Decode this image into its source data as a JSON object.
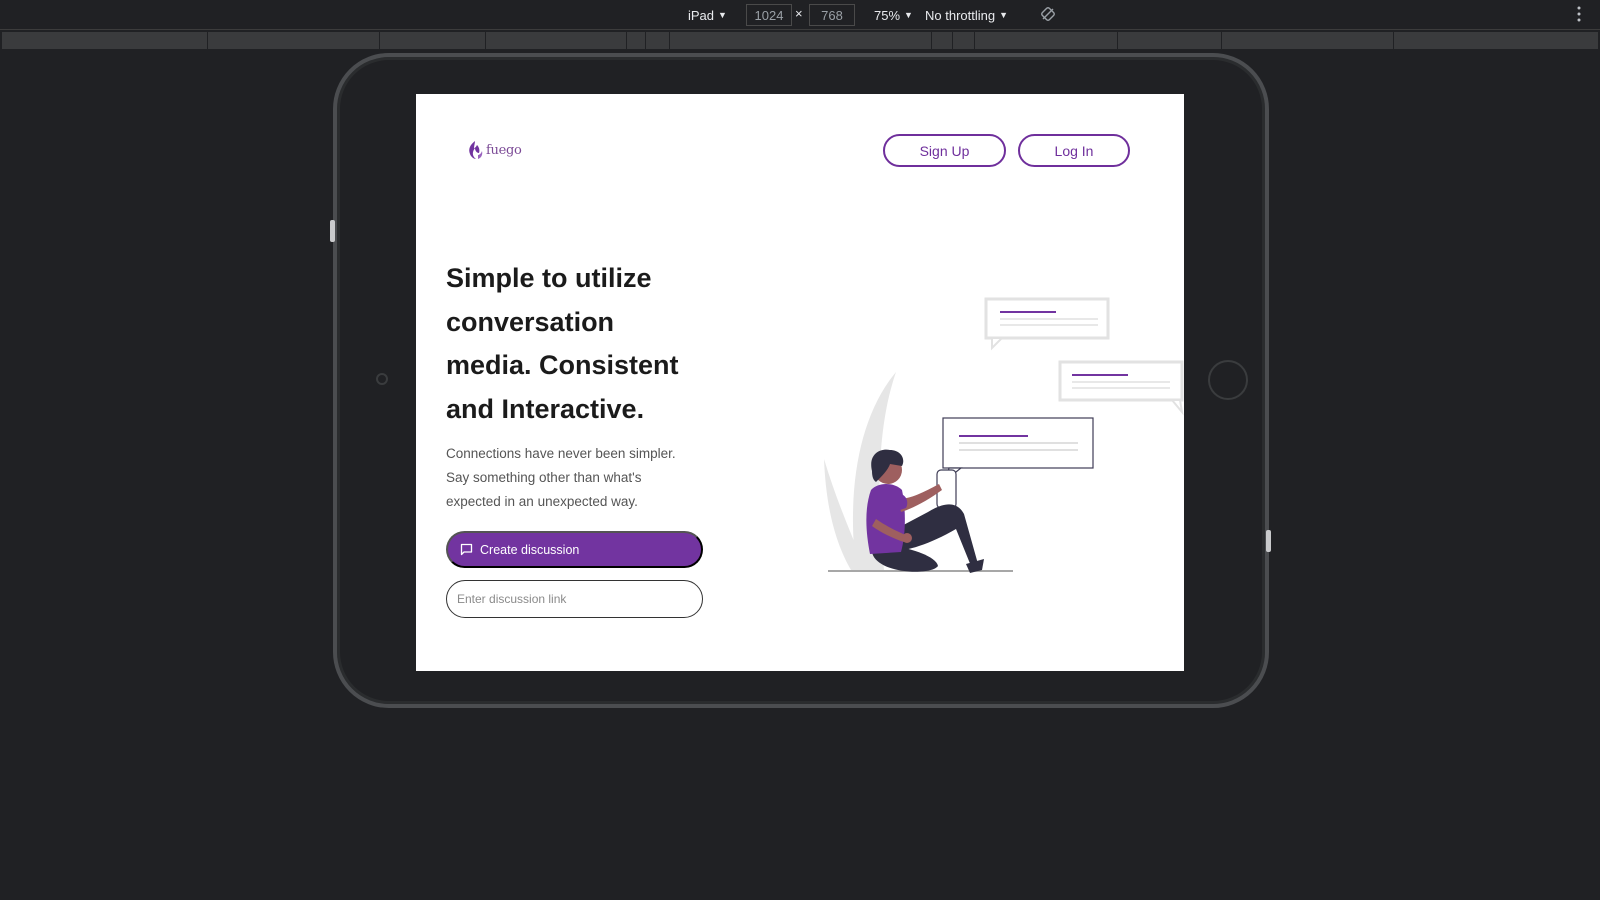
{
  "devtools": {
    "device": "iPad",
    "width": "1024",
    "height": "768",
    "times": "×",
    "zoom": "75%",
    "throttling": "No throttling"
  },
  "app": {
    "logo_text": "fuego",
    "signup_label": "Sign Up",
    "login_label": "Log In",
    "headline": "Simple to utilize conversation media. Consistent and Interactive.",
    "subtext": "Connections have never been simpler. Say something other than what's expected in an unexpected way.",
    "create_label": "Create discussion",
    "link_placeholder": "Enter discussion link"
  },
  "colors": {
    "accent": "#7234a0",
    "accent_outline": "#6f2f9c",
    "skin": "#9e5f5f",
    "illustration_gray": "#e6e6e6",
    "devtools_bg": "#202124"
  }
}
